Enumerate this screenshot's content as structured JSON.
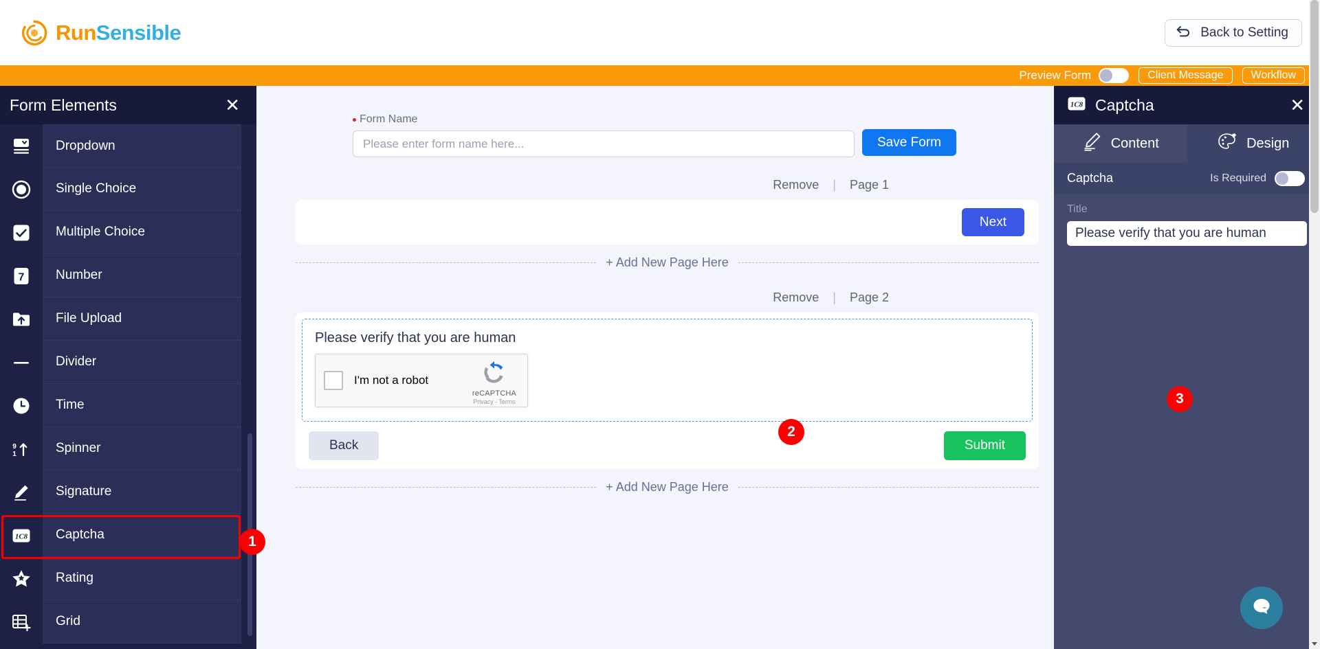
{
  "brand": {
    "part1": "Run",
    "part2": "Sensible",
    "mark_icon": "sunburst-logo-icon"
  },
  "header": {
    "back_button": "Back to Setting",
    "back_icon": "undo-arrow-icon"
  },
  "toolbar": {
    "preview_label": "Preview Form",
    "preview_enabled": false,
    "client_message": "Client Message",
    "workflow": "Workflow"
  },
  "sidebar": {
    "title": "Form Elements",
    "close_icon": "close-icon",
    "items": [
      {
        "label": "Dropdown",
        "icon": "dropdown-icon",
        "highlighted": false
      },
      {
        "label": "Single Choice",
        "icon": "radio-button-icon",
        "highlighted": false
      },
      {
        "label": "Multiple Choice",
        "icon": "checkbox-icon",
        "highlighted": false
      },
      {
        "label": "Number",
        "icon": "number-seven-icon",
        "highlighted": false
      },
      {
        "label": "File Upload",
        "icon": "folder-upload-icon",
        "highlighted": false
      },
      {
        "label": "Divider",
        "icon": "horizontal-line-icon",
        "highlighted": false
      },
      {
        "label": "Time",
        "icon": "clock-icon",
        "highlighted": false
      },
      {
        "label": "Spinner",
        "icon": "spinner-updown-icon",
        "highlighted": false
      },
      {
        "label": "Signature",
        "icon": "pencil-signature-icon",
        "highlighted": false
      },
      {
        "label": "Captcha",
        "icon": "captcha-icon",
        "highlighted": true
      },
      {
        "label": "Rating",
        "icon": "star-icon",
        "highlighted": false
      },
      {
        "label": "Grid",
        "icon": "grid-plus-icon",
        "highlighted": false
      }
    ]
  },
  "badges": [
    {
      "number": "1",
      "color": "#fb0000"
    },
    {
      "number": "2",
      "color": "#fb0000"
    },
    {
      "number": "3",
      "color": "#fb0000"
    }
  ],
  "canvas": {
    "form_name_label": "Form Name",
    "form_name_required": true,
    "form_name_value": "",
    "form_name_placeholder": "Please enter form name here...",
    "save_form_button": "Save Form",
    "page1": {
      "remove_label": "Remove",
      "separator": "|",
      "page_label": "Page 1",
      "next_button": "Next"
    },
    "add_page_1": "+ Add New Page Here",
    "page2": {
      "remove_label": "Remove",
      "separator": "|",
      "page_label": "Page 2",
      "captcha_title": "Please verify that you are human",
      "recaptcha": {
        "checkbox_label": "I'm not a robot",
        "brand": "reCAPTCHA",
        "links": "Privacy - Terms",
        "logo_icon": "recaptcha-logo-icon"
      },
      "back_button": "Back",
      "submit_button": "Submit"
    },
    "add_page_2": "+ Add New Page Here"
  },
  "right_panel": {
    "title": "Captcha",
    "title_icon": "captcha-icon",
    "close_icon": "close-icon",
    "tabs": [
      {
        "label": "Content",
        "icon": "pencil-icon",
        "active": true
      },
      {
        "label": "Design",
        "icon": "palette-icon",
        "active": false
      }
    ],
    "element_name": "Captcha",
    "is_required_label": "Is Required",
    "is_required_enabled": false,
    "title_field_label": "Title",
    "title_field_value": "Please verify that you are human"
  },
  "chat_widget": {
    "icon": "chat-bubble-icon",
    "color": "#2b7e9e"
  },
  "colors": {
    "orange": "#fb9a09",
    "brand_orange": "#f79400",
    "brand_blue": "#35aee2",
    "sidebar_dark": "#1e2145",
    "sidebar_row": "#2b2f58",
    "panel": "#434a6e",
    "save_blue": "#1177f0",
    "next_blue": "#3a58e8",
    "submit_green": "#18c25c",
    "badge_red": "#fb0000"
  }
}
